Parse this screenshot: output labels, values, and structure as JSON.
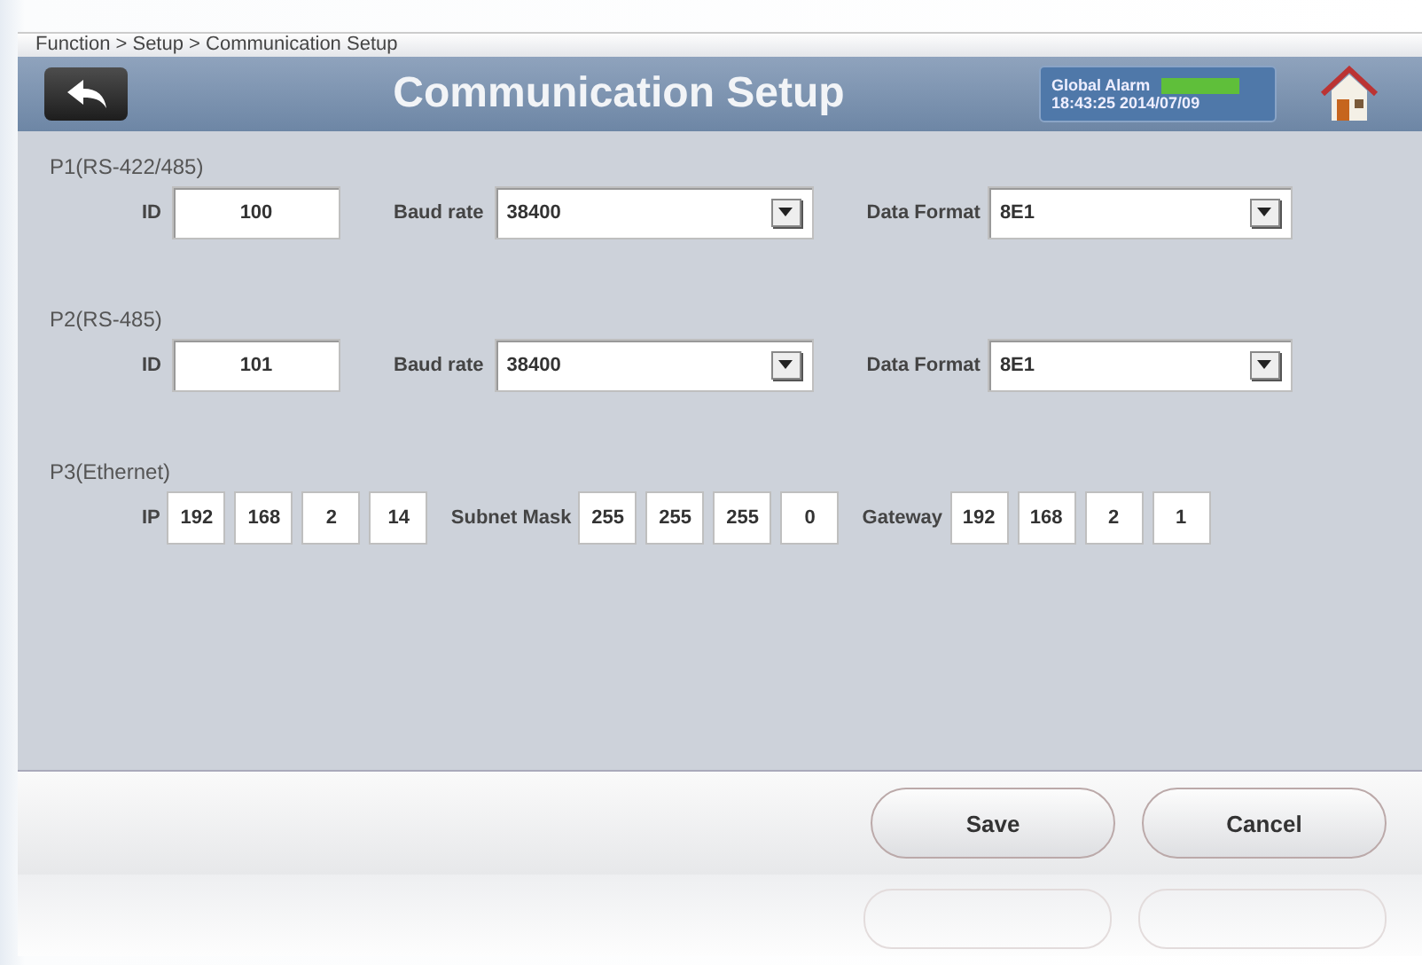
{
  "breadcrumb": "Function > Setup > Communication Setup",
  "header": {
    "title": "Communication Setup",
    "alarm_label": "Global Alarm",
    "alarm_ok": true,
    "datetime": "18:43:25  2014/07/09"
  },
  "sections": [
    {
      "title": "P1(RS-422/485)",
      "kind": "serial",
      "id_label": "ID",
      "id": "100",
      "baud_label": "Baud rate",
      "baud": "38400",
      "format_label": "Data Format",
      "format": "8E1"
    },
    {
      "title": "P2(RS-485)",
      "kind": "serial",
      "id_label": "ID",
      "id": "101",
      "baud_label": "Baud rate",
      "baud": "38400",
      "format_label": "Data Format",
      "format": "8E1"
    },
    {
      "title": "P3(Ethernet)",
      "kind": "ethernet",
      "groups": [
        {
          "label": "IP",
          "octets": [
            "192",
            "168",
            "2",
            "14"
          ]
        },
        {
          "label": "Subnet Mask",
          "octets": [
            "255",
            "255",
            "255",
            "0"
          ]
        },
        {
          "label": "Gateway",
          "octets": [
            "192",
            "168",
            "2",
            "1"
          ]
        }
      ]
    }
  ],
  "buttons": [
    "Save",
    "Cancel"
  ]
}
